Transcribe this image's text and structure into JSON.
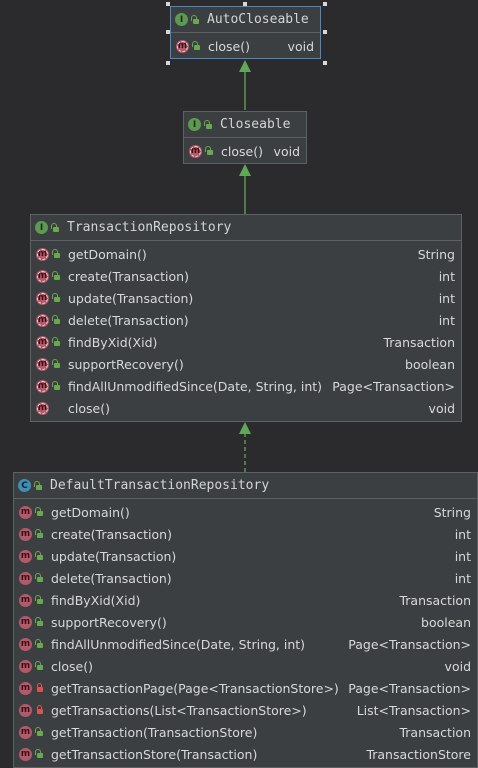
{
  "colors": {
    "background": "#2b2b2d",
    "box": "#3c3f41",
    "arrow": "#5fa85a",
    "selection": "#4a88c7"
  },
  "relations": [
    {
      "from": "Closeable",
      "to": "AutoCloseable",
      "kind": "extends"
    },
    {
      "from": "TransactionRepository",
      "to": "Closeable",
      "kind": "extends"
    },
    {
      "from": "DefaultTransactionRepository",
      "to": "TransactionRepository",
      "kind": "implements"
    }
  ],
  "auto_closeable": {
    "name": "AutoCloseable",
    "kind": "interface",
    "methods": [
      {
        "name": "close()",
        "type": "void",
        "visibility": "public"
      }
    ]
  },
  "closeable": {
    "name": "Closeable",
    "kind": "interface",
    "methods": [
      {
        "name": "close()",
        "type": "void",
        "visibility": "public"
      }
    ]
  },
  "transaction_repository": {
    "name": "TransactionRepository",
    "kind": "interface",
    "methods": [
      {
        "name": "getDomain()",
        "type": "String",
        "visibility": "public"
      },
      {
        "name": "create(Transaction)",
        "type": "int",
        "visibility": "public"
      },
      {
        "name": "update(Transaction)",
        "type": "int",
        "visibility": "public"
      },
      {
        "name": "delete(Transaction)",
        "type": "int",
        "visibility": "public"
      },
      {
        "name": "findByXid(Xid)",
        "type": "Transaction",
        "visibility": "public"
      },
      {
        "name": "supportRecovery()",
        "type": "boolean",
        "visibility": "public"
      },
      {
        "name": "findAllUnmodifiedSince(Date, String, int)",
        "type": "Page<Transaction>",
        "visibility": "public"
      },
      {
        "name": "close()",
        "type": "void",
        "visibility": "none"
      }
    ]
  },
  "default_transaction_repository": {
    "name": "DefaultTransactionRepository",
    "kind": "class",
    "methods": [
      {
        "name": "getDomain()",
        "type": "String",
        "visibility": "public"
      },
      {
        "name": "create(Transaction)",
        "type": "int",
        "visibility": "public"
      },
      {
        "name": "update(Transaction)",
        "type": "int",
        "visibility": "public"
      },
      {
        "name": "delete(Transaction)",
        "type": "int",
        "visibility": "public"
      },
      {
        "name": "findByXid(Xid)",
        "type": "Transaction",
        "visibility": "public"
      },
      {
        "name": "supportRecovery()",
        "type": "boolean",
        "visibility": "public"
      },
      {
        "name": "findAllUnmodifiedSince(Date, String, int)",
        "type": "Page<Transaction>",
        "visibility": "public"
      },
      {
        "name": "close()",
        "type": "void",
        "visibility": "public"
      },
      {
        "name": "getTransactionPage(Page<TransactionStore>)",
        "type": "Page<Transaction>",
        "visibility": "private"
      },
      {
        "name": "getTransactions(List<TransactionStore>)",
        "type": "List<Transaction>",
        "visibility": "private"
      },
      {
        "name": "getTransaction(TransactionStore)",
        "type": "Transaction",
        "visibility": "public"
      },
      {
        "name": "getTransactionStore(Transaction)",
        "type": "TransactionStore",
        "visibility": "public"
      }
    ]
  }
}
